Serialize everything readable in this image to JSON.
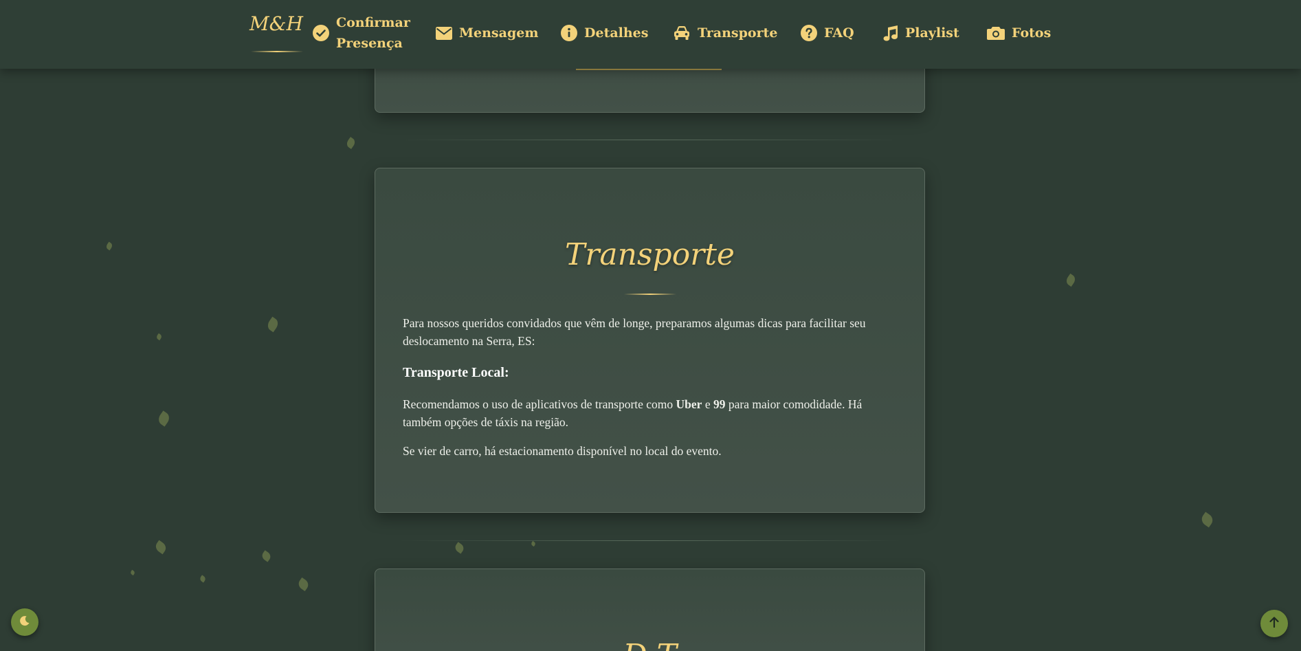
{
  "nav": {
    "brand": "M&H",
    "items": [
      {
        "label": "Confirmar Presença",
        "icon": "check-circle-icon"
      },
      {
        "label": "Mensagem",
        "icon": "envelope-icon"
      },
      {
        "label": "Detalhes",
        "icon": "info-circle-icon"
      },
      {
        "label": "Transporte",
        "icon": "car-icon"
      },
      {
        "label": "FAQ",
        "icon": "question-circle-icon"
      },
      {
        "label": "Playlist",
        "icon": "music-note-icon"
      },
      {
        "label": "Fotos",
        "icon": "camera-icon"
      }
    ]
  },
  "transport": {
    "title": "Transporte",
    "intro": "Para nossos queridos convidados que vêm de longe, preparamos algumas dicas para facilitar seu deslocamento na Serra, ES:",
    "subheading": "Transporte Local:",
    "rec_before": "Recomendamos o uso de aplicativos de transporte como ",
    "rec_uber": "Uber",
    "rec_and": " e ",
    "rec_99": "99",
    "rec_after": " para maior comodidade. Há também opções de táxis na região.",
    "parking": "Se vier de carro, há estacionamento disponível no local do evento."
  },
  "next_section": {
    "title_partial": "D             T"
  },
  "colors": {
    "background": "#2e3d34",
    "accent": "#f3d27a",
    "button": "#6f8b3a"
  }
}
